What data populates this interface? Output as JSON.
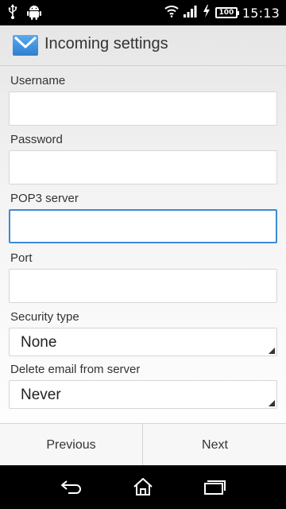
{
  "status_bar": {
    "time": "15:13",
    "battery_level": "100",
    "icons": [
      "usb-icon",
      "android-icon",
      "wifi-icon",
      "signal-icon",
      "charging-icon",
      "battery-icon"
    ]
  },
  "action_bar": {
    "icon": "email-envelope-icon",
    "title": "Incoming settings"
  },
  "form": {
    "username": {
      "label": "Username",
      "value": ""
    },
    "password": {
      "label": "Password",
      "value": ""
    },
    "pop3_server": {
      "label": "POP3 server",
      "value": ""
    },
    "port": {
      "label": "Port",
      "value": ""
    },
    "security_type": {
      "label": "Security type",
      "value": "None"
    },
    "delete_email": {
      "label": "Delete email from server",
      "value": "Never"
    }
  },
  "buttons": {
    "previous": "Previous",
    "next": "Next"
  },
  "nav_bar": {
    "icons": [
      "back-icon",
      "home-icon",
      "recent-apps-icon"
    ]
  },
  "colors": {
    "focus_accent": "#3b8bd6",
    "envelope": "#3a8fd9"
  }
}
